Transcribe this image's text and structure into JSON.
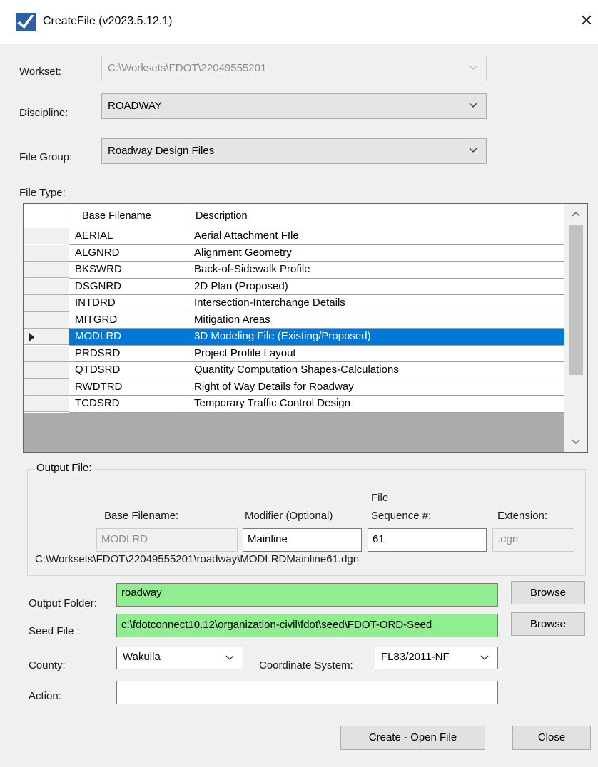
{
  "window": {
    "title": "CreateFile (v2023.5.12.1)",
    "close_glyph": "✕"
  },
  "workset": {
    "label": "Workset:",
    "value": "C:\\Worksets\\FDOT\\22049555201"
  },
  "discipline": {
    "label": "Discipline:",
    "value": "ROADWAY"
  },
  "file_group": {
    "label": "File Group:",
    "value": "Roadway Design Files"
  },
  "file_type": {
    "label": "File Type:",
    "columns": [
      "Base Filename",
      "Description"
    ],
    "rows": [
      {
        "base": "AERIAL",
        "desc": "Aerial Attachment FIle"
      },
      {
        "base": "ALGNRD",
        "desc": "Alignment Geometry"
      },
      {
        "base": "BKSWRD",
        "desc": "Back-of-Sidewalk Profile"
      },
      {
        "base": "DSGNRD",
        "desc": "2D Plan (Proposed)"
      },
      {
        "base": "INTDRD",
        "desc": "Intersection-Interchange Details"
      },
      {
        "base": "MITGRD",
        "desc": "Mitigation Areas"
      },
      {
        "base": "MODLRD",
        "desc": "3D Modeling File (Existing/Proposed)",
        "selected": true
      },
      {
        "base": "PRDSRD",
        "desc": "Project Profile Layout"
      },
      {
        "base": "QTDSRD",
        "desc": "Quantity Computation Shapes-Calculations"
      },
      {
        "base": "RWDTRD",
        "desc": "Right of Way Details for Roadway"
      },
      {
        "base": "TCDSRD",
        "desc": "Temporary Traffic Control Design"
      }
    ]
  },
  "output_file": {
    "group_label": "Output File:",
    "base_label": "Base Filename:",
    "modifier_label": "Modifier (Optional)",
    "sequence_label_line1": "File",
    "sequence_label_line2": "Sequence #:",
    "extension_label": "Extension:",
    "base_value": "MODLRD",
    "modifier_value": "Mainline",
    "sequence_value": "61",
    "extension_value": ".dgn",
    "full_path": "C:\\Worksets\\FDOT\\22049555201\\roadway\\MODLRDMainline61.dgn"
  },
  "output_folder": {
    "label": "Output Folder:",
    "value": "roadway",
    "browse": "Browse"
  },
  "seed_file": {
    "label": "Seed File :",
    "value": "c:\\fdotconnect10.12\\organization-civil\\fdot\\seed\\FDOT-ORD-Seed",
    "browse": "Browse"
  },
  "county": {
    "label": "County:",
    "value": "Wakulla"
  },
  "coordinate_system": {
    "label": "Coordinate System:",
    "value": "FL83/2011-NF"
  },
  "action": {
    "label": "Action:",
    "value": ""
  },
  "buttons": {
    "create_open": "Create - Open File",
    "close": "Close"
  },
  "colors": {
    "selection": "#0078d7",
    "highlight_field": "#90ee90",
    "dialog_bg": "#f0f0f0"
  }
}
